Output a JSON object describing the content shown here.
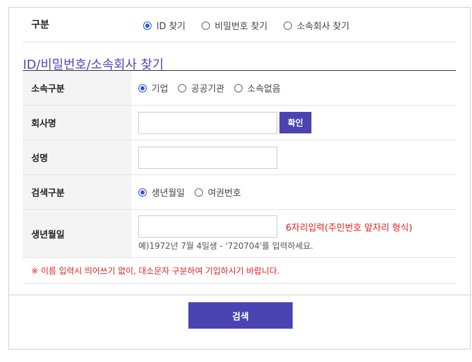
{
  "find_type": {
    "label": "구분",
    "options": [
      {
        "label": "ID 찾기",
        "checked": true
      },
      {
        "label": "비밀번호 찾기",
        "checked": false
      },
      {
        "label": "소속회사 찾기",
        "checked": false
      }
    ]
  },
  "section_title": "ID/비밀번호/소속회사 찾기",
  "form": {
    "affiliation": {
      "label": "소속구분",
      "options": [
        {
          "label": "기업",
          "checked": true
        },
        {
          "label": "공공기관",
          "checked": false
        },
        {
          "label": "소속없음",
          "checked": false
        }
      ]
    },
    "company": {
      "label": "회사명",
      "value": "",
      "button": "확인"
    },
    "name": {
      "label": "성명",
      "value": ""
    },
    "search_type": {
      "label": "검색구분",
      "options": [
        {
          "label": "생년월일",
          "checked": true
        },
        {
          "label": "여권번호",
          "checked": false
        }
      ]
    },
    "birthdate": {
      "label": "생년월일",
      "value": "",
      "hint": "6자리입력(주민번호 앞자리 형식)",
      "example": "예)1972년 7월 4일생 - '720704'를 입력하세요."
    },
    "notice": "※ 이름 입력시 띄어쓰기 없이, 대소문자 구분하여 기입하시기 바랍니다."
  },
  "search_button": "검색",
  "colors": {
    "accent": "#4a44b3",
    "title": "#5146b8",
    "warning": "#e02020",
    "radio": "#2b56c7"
  }
}
